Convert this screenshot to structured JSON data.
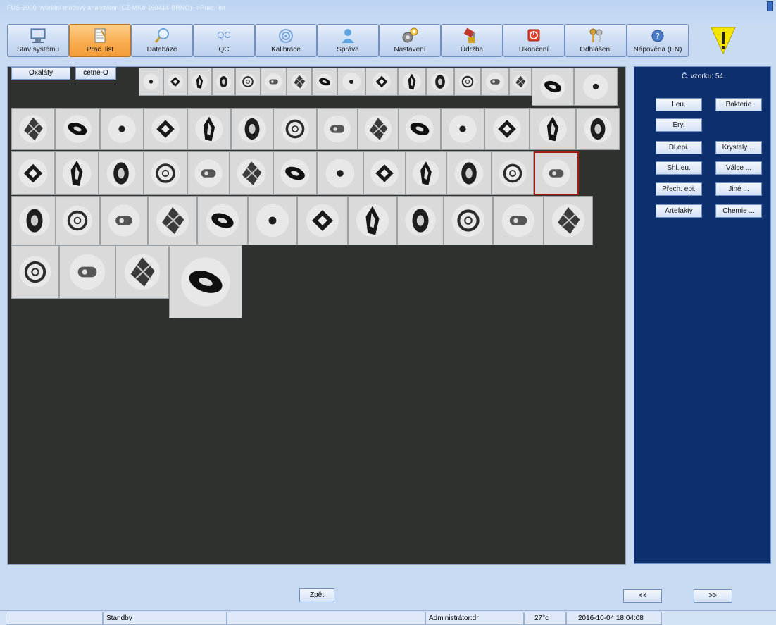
{
  "window": {
    "title": "FUS-2000 hybridní močový analyzátor (CZ-MKo-160414-BRNO)-->Prac. list"
  },
  "toolbar": [
    {
      "label": "Stav systému",
      "icon": "monitor-icon"
    },
    {
      "label": "Prac. list",
      "icon": "worksheet-icon",
      "active": true
    },
    {
      "label": "Databáze",
      "icon": "magnifier-icon"
    },
    {
      "label": "QC",
      "icon": "qc-icon"
    },
    {
      "label": "Kalibrace",
      "icon": "target-icon"
    },
    {
      "label": "Správa",
      "icon": "user-icon"
    },
    {
      "label": "Nastavení",
      "icon": "gears-icon"
    },
    {
      "label": "Údržba",
      "icon": "tools-icon"
    },
    {
      "label": "Ukončení",
      "icon": "power-icon"
    },
    {
      "label": "Odhlášení",
      "icon": "keys-icon"
    },
    {
      "label": "Nápověda (EN)",
      "icon": "help-icon"
    }
  ],
  "qc_icon_text": "QC",
  "category_tabs": [
    "Oxaláty",
    "cetne-O"
  ],
  "side_panel": {
    "sample_label": "Č. vzorku: 54",
    "buttons": [
      {
        "label": "Leu."
      },
      {
        "label": "Bakterie"
      },
      {
        "label": "Ery."
      },
      {
        "label": "Dl.epi."
      },
      {
        "label": "Krystaly ..."
      },
      {
        "label": "Shl.leu."
      },
      {
        "label": "Válce ..."
      },
      {
        "label": "Přech. epi."
      },
      {
        "label": "Jiné ..."
      },
      {
        "label": "Artefakty"
      },
      {
        "label": "Chemie ..."
      }
    ]
  },
  "navigation": {
    "back_label": "Zpět",
    "prev_label": "<<",
    "next_label": ">>"
  },
  "status_bar": {
    "state": "Standby",
    "user": "Administrátor:dr",
    "temperature": "27°c",
    "datetime": "2016-10-04 18:04:08"
  },
  "colors": {
    "accent_active": "#f8aa4b",
    "side_panel_bg": "#0e2f6e",
    "main_panel_bg": "#2e312e",
    "selected_border": "#a81a12",
    "warning_yellow": "#f5e600"
  },
  "images": {
    "count": 56,
    "selected_index": 43
  }
}
